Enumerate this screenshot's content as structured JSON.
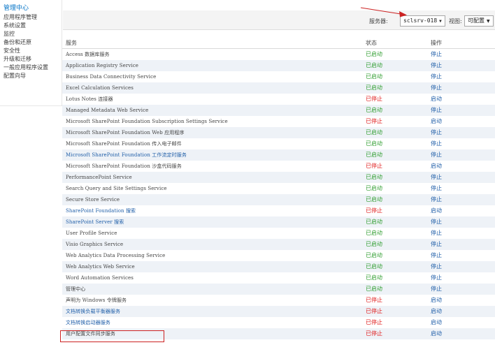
{
  "nav": [
    {
      "label": "管理中心",
      "selected": true
    },
    {
      "label": "应用程序管理"
    },
    {
      "label": "系统设置"
    },
    {
      "label": "监控"
    },
    {
      "label": "备份和还原"
    },
    {
      "label": "安全性"
    },
    {
      "label": "升级和迁移"
    },
    {
      "label": "一般应用程序设置"
    },
    {
      "label": "配置向导"
    }
  ],
  "toolbar": {
    "server_label": "服务器:",
    "server_value": "sclsrv-018",
    "view_label": "视图:",
    "view_value": "可配置"
  },
  "table": {
    "headers": {
      "service": "服务",
      "status": "状态",
      "action": "操作"
    },
    "rows": [
      {
        "service": "Access 数据库服务",
        "status": "已启动",
        "action": "停止"
      },
      {
        "service": "Application Registry Service",
        "status": "已启动",
        "action": "停止"
      },
      {
        "service": "Business Data Connectivity Service",
        "status": "已启动",
        "action": "停止"
      },
      {
        "service": "Excel Calculation Services",
        "status": "已启动",
        "action": "停止"
      },
      {
        "service": "Lotus Notes 连接器",
        "status": "已停止",
        "action": "启动"
      },
      {
        "service": "Managed Metadata Web Service",
        "status": "已启动",
        "action": "停止"
      },
      {
        "service": "Microsoft SharePoint Foundation Subscription Settings Service",
        "status": "已停止",
        "action": "启动"
      },
      {
        "service": "Microsoft SharePoint Foundation Web 应用程序",
        "status": "已启动",
        "action": "停止"
      },
      {
        "service": "Microsoft SharePoint Foundation 传入电子邮件",
        "status": "已启动",
        "action": "停止"
      },
      {
        "service": "Microsoft SharePoint Foundation 工作流定时服务",
        "status": "已启动",
        "action": "停止",
        "link": true
      },
      {
        "service": "Microsoft SharePoint Foundation 沙盒代码服务",
        "status": "已停止",
        "action": "启动"
      },
      {
        "service": "PerformancePoint Service",
        "status": "已启动",
        "action": "停止"
      },
      {
        "service": "Search Query and Site Settings Service",
        "status": "已启动",
        "action": "停止"
      },
      {
        "service": "Secure Store Service",
        "status": "已启动",
        "action": "停止"
      },
      {
        "service": "SharePoint Foundation 搜索",
        "status": "已停止",
        "action": "启动",
        "link": true
      },
      {
        "service": "SharePoint Server 搜索",
        "status": "已启动",
        "action": "停止",
        "link": true
      },
      {
        "service": "User Profile Service",
        "status": "已启动",
        "action": "停止"
      },
      {
        "service": "Visio Graphics Service",
        "status": "已启动",
        "action": "停止"
      },
      {
        "service": "Web Analytics Data Processing Service",
        "status": "已启动",
        "action": "停止"
      },
      {
        "service": "Web Analytics Web Service",
        "status": "已启动",
        "action": "停止"
      },
      {
        "service": "Word Automation Services",
        "status": "已启动",
        "action": "停止"
      },
      {
        "service": "管理中心",
        "status": "已启动",
        "action": "停止"
      },
      {
        "service": "声明为 Windows 令牌服务",
        "status": "已停止",
        "action": "启动"
      },
      {
        "service": "文档转换负载平衡器服务",
        "status": "已停止",
        "action": "启动",
        "link": true
      },
      {
        "service": "文档转换启动器服务",
        "status": "已停止",
        "action": "启动",
        "link": true
      },
      {
        "service": "用户配置文件同步服务",
        "status": "已停止",
        "action": "启动"
      }
    ]
  },
  "colors": {
    "started": "#2f9d2f",
    "stopped": "#e02020",
    "link": "#1f5ea8",
    "nav_selected": "#0072c6",
    "annotation": "#cc2222"
  }
}
